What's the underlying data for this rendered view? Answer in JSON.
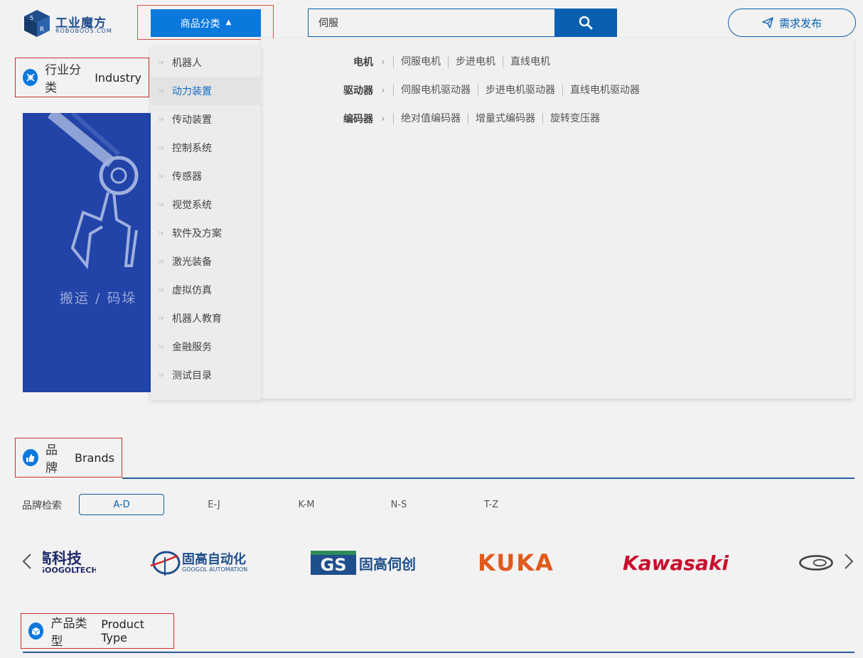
{
  "header": {
    "logo_text": "工业魔方",
    "logo_sub": "ROBOBOOS.COM",
    "category_button": "商品分类",
    "search_value": "伺服",
    "demand_button": "需求发布"
  },
  "sections": {
    "industry": {
      "zh": "行业分类",
      "en": "Industry"
    },
    "brands": {
      "zh": "品牌",
      "en": "Brands"
    },
    "product_type": {
      "zh": "产品类型",
      "en": "Product Type"
    }
  },
  "industry_card": {
    "label": "搬运 / 码垛"
  },
  "dropdown": {
    "items": [
      "机器人",
      "动力装置",
      "传动装置",
      "控制系统",
      "传感器",
      "视觉系统",
      "软件及方案",
      "激光装备",
      "虚拟仿真",
      "机器人教育",
      "金融服务",
      "测试目录"
    ],
    "active_index": 1
  },
  "subpanel": {
    "rows": [
      {
        "category": "电机",
        "links": [
          "伺服电机",
          "步进电机",
          "直线电机"
        ]
      },
      {
        "category": "驱动器",
        "links": [
          "伺服电机驱动器",
          "步进电机驱动器",
          "直线电机驱动器"
        ]
      },
      {
        "category": "编码器",
        "links": [
          "绝对值编码器",
          "增量式编码器",
          "旋转变压器"
        ]
      }
    ]
  },
  "brand_filter": {
    "label": "品牌检索",
    "tabs": [
      "A-D",
      "E-J",
      "K-M",
      "N-S",
      "T-Z"
    ],
    "active": "A-D"
  },
  "brand_logos": {
    "googoltech": {
      "zh": "高科技",
      "en": "GOOGOLTECH"
    },
    "googol_automation": {
      "zh": "固高自动化",
      "en": "GOOGOL AUTOMATION"
    },
    "gs": {
      "mark": "GS",
      "zh": "固高伺创"
    },
    "kuka": "KUKA",
    "kawasaki": "Kawasaki"
  },
  "colors": {
    "primary": "#0a78dd",
    "dark_blue": "#0a5fb0",
    "kuka_orange": "#e05a1c",
    "kawasaki_red": "#c8102e",
    "gs_green": "#2e8b57",
    "card_blue": "#2244a8"
  },
  "icons": {
    "search": "magnifier-icon",
    "demand": "paper-plane-icon",
    "industry": "grid-icon",
    "brands": "thumbs-up-icon",
    "product_type": "cube-icon",
    "dropdown_item": "pointing-hand-icon"
  }
}
